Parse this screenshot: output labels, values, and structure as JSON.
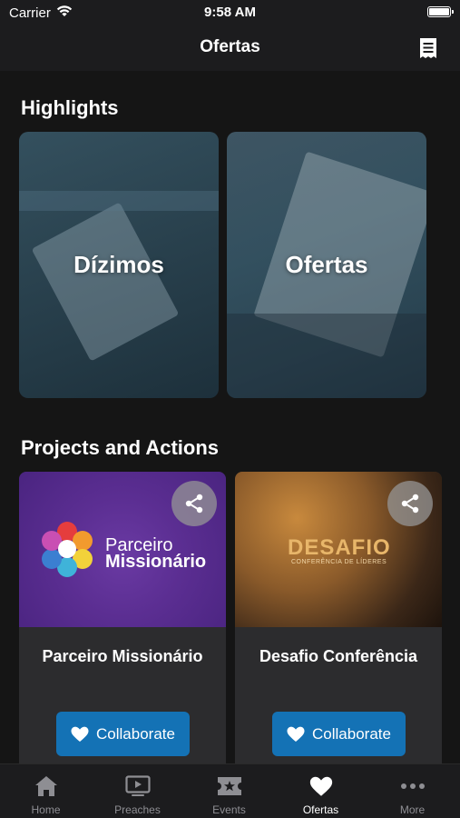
{
  "status": {
    "carrier": "Carrier",
    "time": "9:58 AM"
  },
  "nav": {
    "title": "Ofertas",
    "right_icon": "receipt-icon"
  },
  "highlights": {
    "title": "Highlights",
    "cards": [
      {
        "label": "Dízimos"
      },
      {
        "label": "Ofertas"
      }
    ]
  },
  "projects": {
    "title": "Projects and Actions",
    "cards": [
      {
        "title": "Parceiro Missionário",
        "logo_line1": "Parceiro",
        "logo_line2": "Missionário",
        "button": "Collaborate"
      },
      {
        "title": "Desafio Conferência",
        "logo_line1": "DESAFIO",
        "logo_line2": "CONFERÊNCIA DE LÍDERES",
        "button": "Collaborate"
      }
    ]
  },
  "tabs": [
    {
      "label": "Home",
      "icon": "home-icon",
      "active": false
    },
    {
      "label": "Preaches",
      "icon": "video-icon",
      "active": false
    },
    {
      "label": "Events",
      "icon": "ticket-icon",
      "active": false
    },
    {
      "label": "Ofertas",
      "icon": "heart-icon",
      "active": true
    },
    {
      "label": "More",
      "icon": "more-icon",
      "active": false
    }
  ],
  "colors": {
    "accent_button": "#1472b5",
    "background": "#151515",
    "bar": "#1c1c1e",
    "card": "#2c2c2e"
  }
}
